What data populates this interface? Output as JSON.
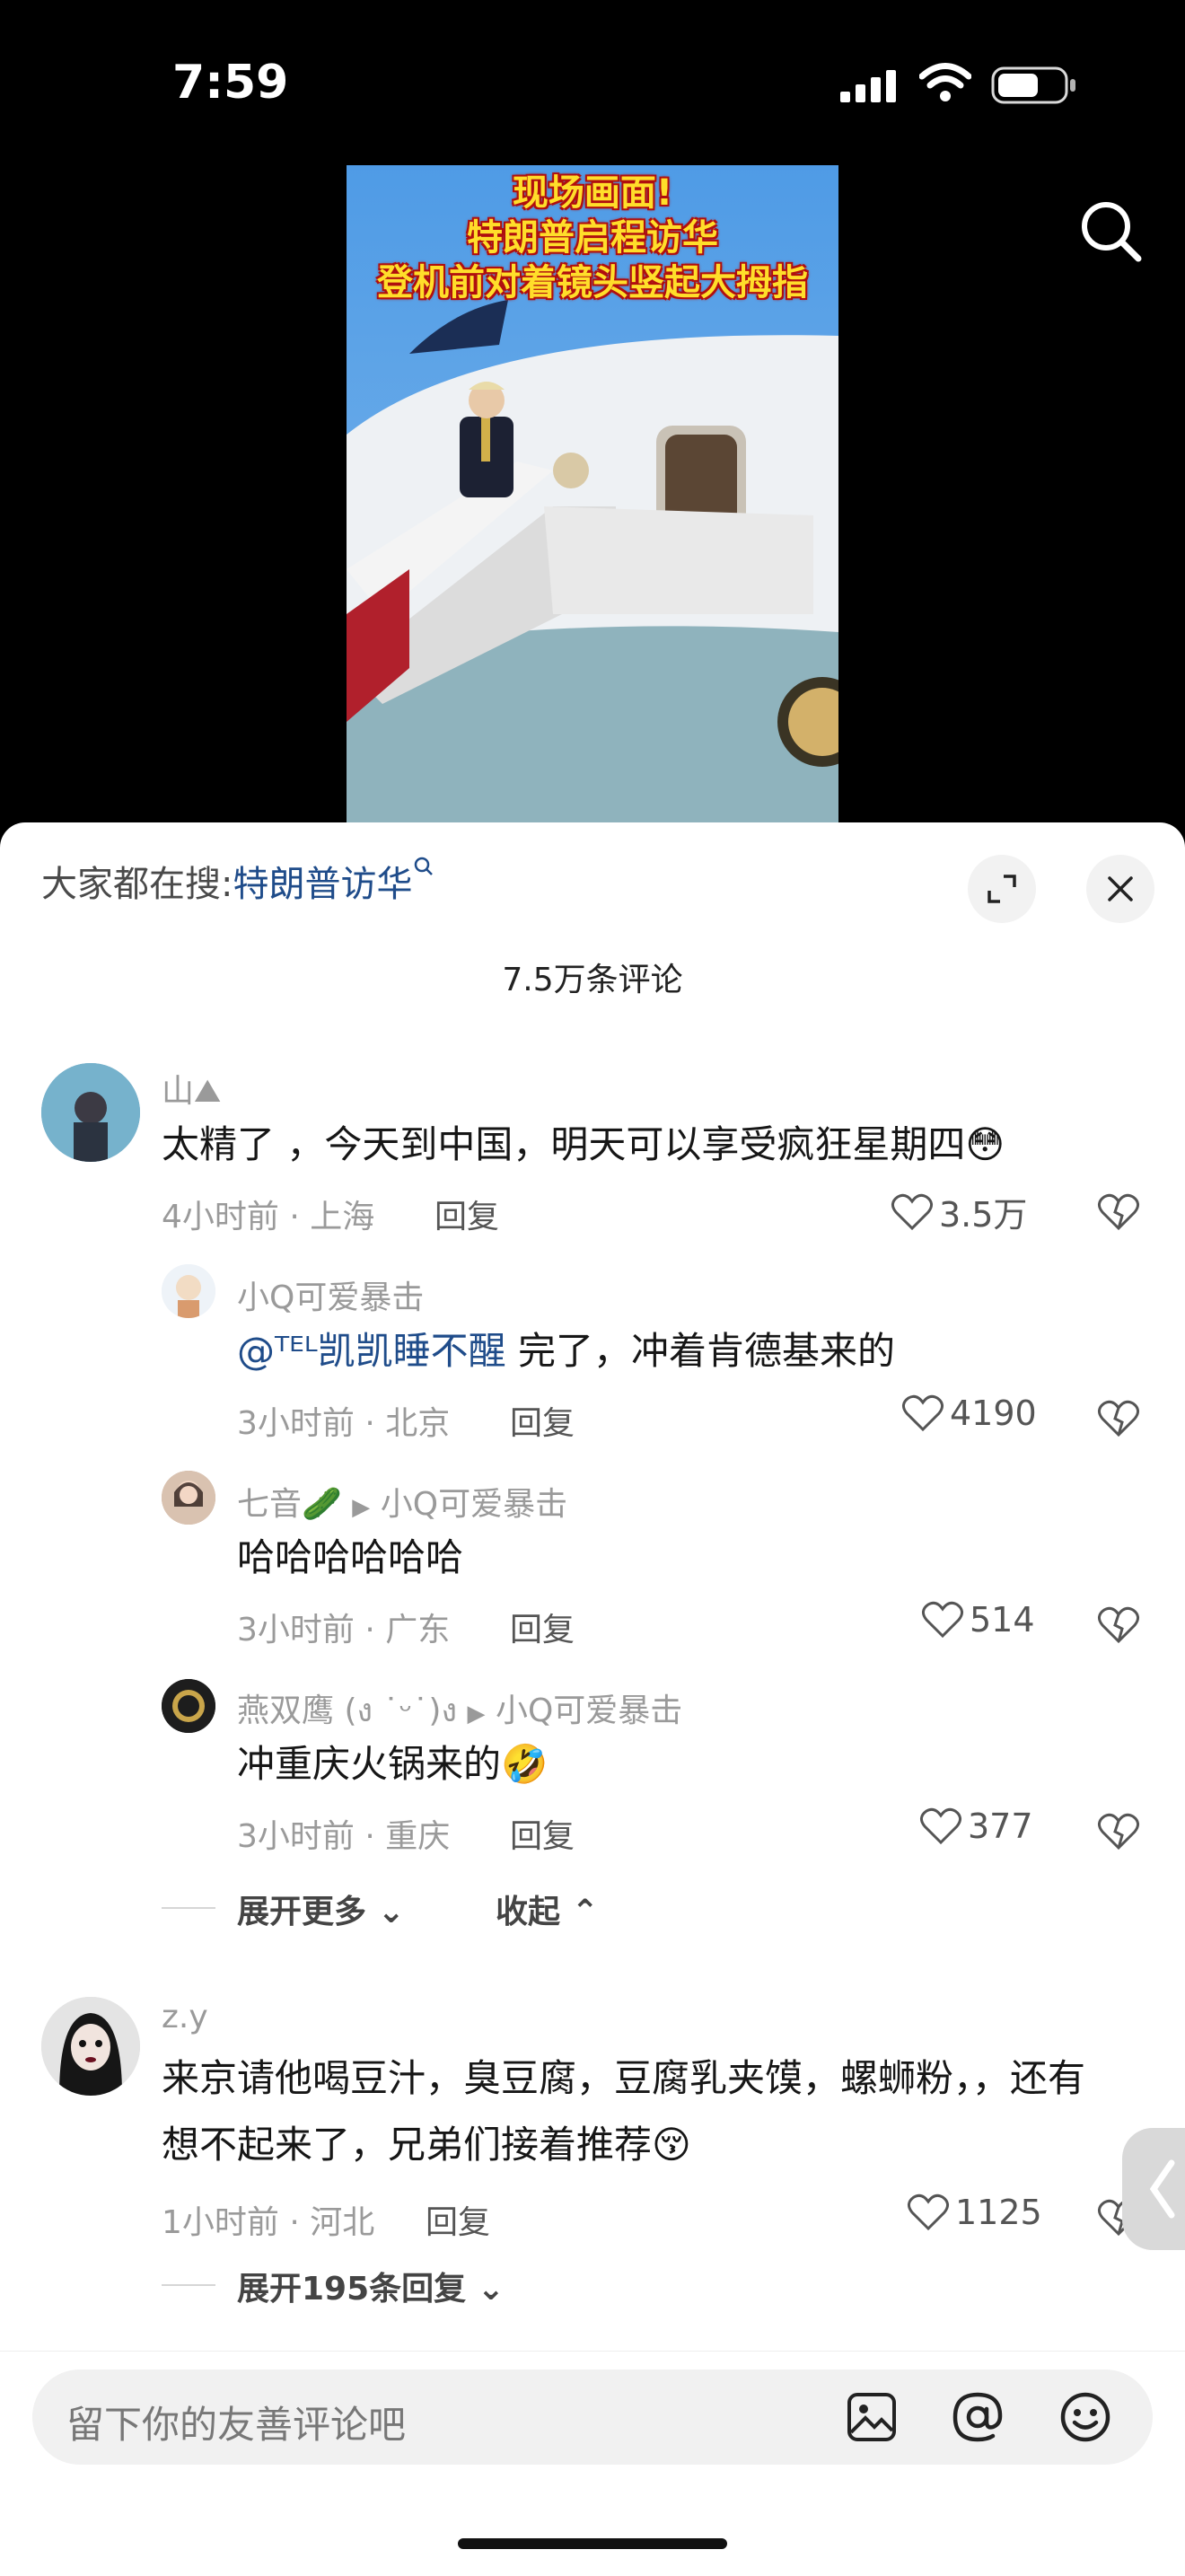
{
  "status": {
    "time": "7:59"
  },
  "video": {
    "title_lines": [
      "现场画面!",
      "特朗普启程访华",
      "登机前对着镜头竖起大拇指"
    ]
  },
  "sheet": {
    "trend_prefix": "大家都在搜:",
    "trend_keyword": "特朗普访华",
    "comment_count": "7.5万条评论"
  },
  "comments": [
    {
      "user": "山⛰",
      "text": "太精了 ，今天到中国，明天可以享受疯狂星期四😳",
      "meta": "4小时前 · 上海",
      "reply": "回复",
      "likes": "3.5万"
    },
    {
      "user": "小Q可爱暴击",
      "mention": "@ᵀᴱᴸ凯凯睡不醒",
      "text": " 完了，冲着肯德基来的",
      "meta": "3小时前 · 北京",
      "reply": "回复",
      "likes": "4190"
    },
    {
      "user": "七音🥒",
      "reply_to": "小Q可爱暴击",
      "text": "哈哈哈哈哈哈",
      "meta": "3小时前 · 广东",
      "reply": "回复",
      "likes": "514"
    },
    {
      "user": "燕双鹰 (ง ˙ᵕ˙)ง",
      "reply_to": "小Q可爱暴击",
      "text": "冲重庆火锅来的🤣",
      "meta": "3小时前 · 重庆",
      "reply": "回复",
      "likes": "377"
    },
    {
      "user": "z.y",
      "text": "来京请他喝豆汁，臭豆腐，豆腐乳夹馍，螺蛳粉，，还有想不起来了，兄弟们接着推荐😚",
      "meta": "1小时前 · 河北",
      "reply": "回复",
      "likes": "1125"
    }
  ],
  "folds": {
    "expand_more": "展开更多",
    "collapse": "收起",
    "expand_replies": "展开195条回复"
  },
  "composer": {
    "placeholder": "留下你的友善评论吧"
  }
}
